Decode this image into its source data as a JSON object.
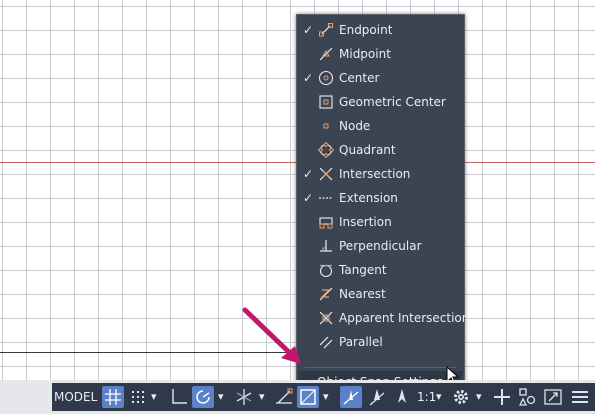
{
  "menu": {
    "items": [
      {
        "label": "Endpoint",
        "checked": true,
        "icon": "endpoint-icon"
      },
      {
        "label": "Midpoint",
        "checked": false,
        "icon": "midpoint-icon"
      },
      {
        "label": "Center",
        "checked": true,
        "icon": "center-icon"
      },
      {
        "label": "Geometric Center",
        "checked": false,
        "icon": "geometric-center-icon"
      },
      {
        "label": "Node",
        "checked": false,
        "icon": "node-icon"
      },
      {
        "label": "Quadrant",
        "checked": false,
        "icon": "quadrant-icon"
      },
      {
        "label": "Intersection",
        "checked": true,
        "icon": "intersection-icon"
      },
      {
        "label": "Extension",
        "checked": true,
        "icon": "extension-icon"
      },
      {
        "label": "Insertion",
        "checked": false,
        "icon": "insertion-icon"
      },
      {
        "label": "Perpendicular",
        "checked": false,
        "icon": "perpendicular-icon"
      },
      {
        "label": "Tangent",
        "checked": false,
        "icon": "tangent-icon"
      },
      {
        "label": "Nearest",
        "checked": false,
        "icon": "nearest-icon"
      },
      {
        "label": "Apparent Intersection",
        "checked": false,
        "icon": "apparent-intersection-icon"
      },
      {
        "label": "Parallel",
        "checked": false,
        "icon": "parallel-icon"
      }
    ],
    "check_glyph": "✓",
    "settings_label": "Object Snap Settings..."
  },
  "statusbar": {
    "model_label": "MODEL",
    "scale_label": "1:1",
    "dropdown_glyph": "▾"
  },
  "colors": {
    "menu_bg": "#3b4453",
    "statusbar_bg": "#2f3949",
    "active_button": "#5b82c9",
    "annotation_arrow": "#c2186b",
    "snap_marker": "#e8a06a"
  }
}
